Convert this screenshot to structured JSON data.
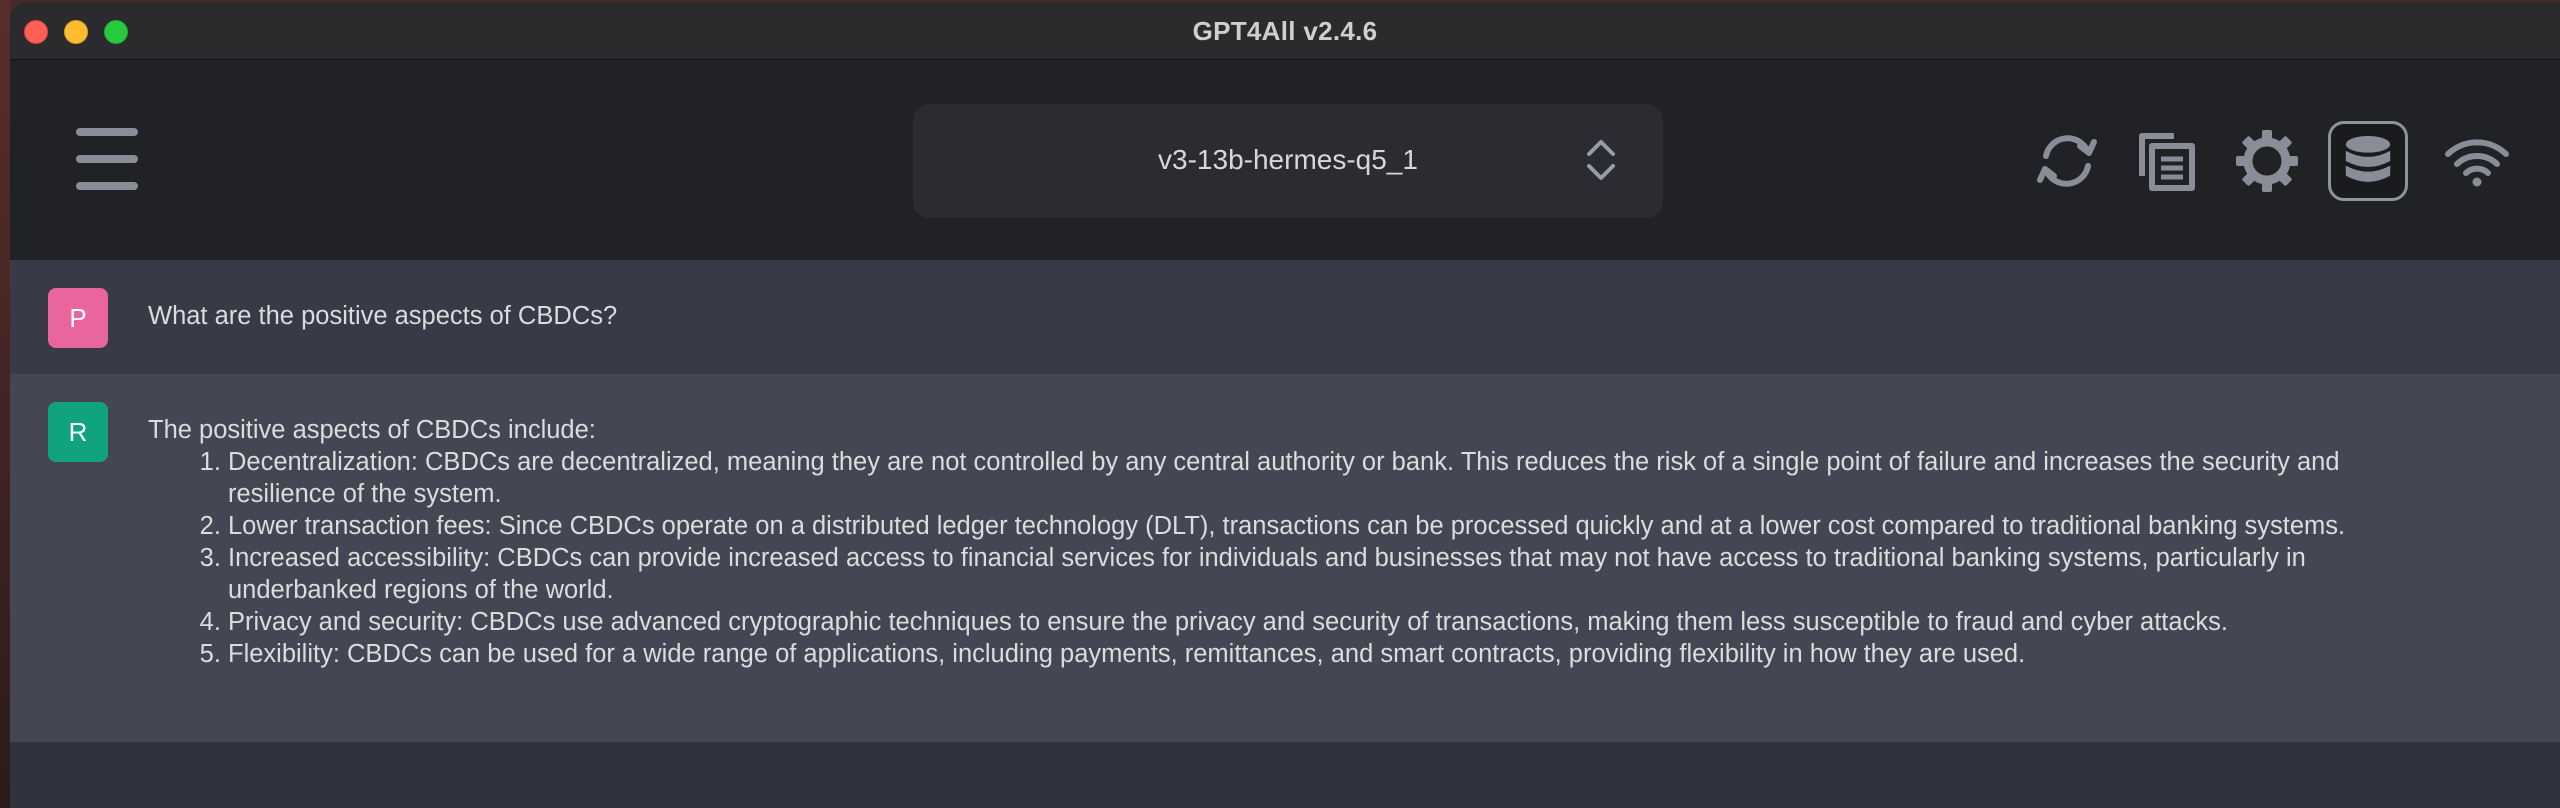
{
  "window": {
    "title": "GPT4All v2.4.6"
  },
  "header": {
    "model_name": "v3-13b-hermes-q5_1",
    "icons": [
      "menu-icon",
      "reset-icon",
      "copy-icon",
      "settings-icon",
      "database-icon",
      "network-icon"
    ]
  },
  "conversation": {
    "prompt": {
      "avatar_letter": "P",
      "text": "What are the positive aspects of CBDCs?"
    },
    "response": {
      "avatar_letter": "R",
      "intro": "The positive aspects of CBDCs include:",
      "items": [
        "Decentralization: CBDCs are decentralized, meaning they are not controlled by any central authority or bank. This reduces the risk of a single point of failure and increases the security and resilience of the system.",
        "Lower transaction fees: Since CBDCs operate on a distributed ledger technology (DLT), transactions can be processed quickly and at a lower cost compared to traditional banking systems.",
        "Increased accessibility: CBDCs can provide increased access to financial services for individuals and businesses that may not have access to traditional banking systems, particularly in underbanked regions of the world.",
        "Privacy and security: CBDCs use advanced cryptographic techniques to ensure the privacy and security of transactions, making them less susceptible to fraud and cyber attacks.",
        "Flexibility: CBDCs can be used for a wide range of applications, including payments, remittances, and smart contracts, providing flexibility in how they are used."
      ]
    }
  },
  "colors": {
    "prompt_avatar": "#e8659e",
    "response_avatar": "#10a37f",
    "prompt_bg": "#383a48",
    "response_bg": "#444654"
  }
}
